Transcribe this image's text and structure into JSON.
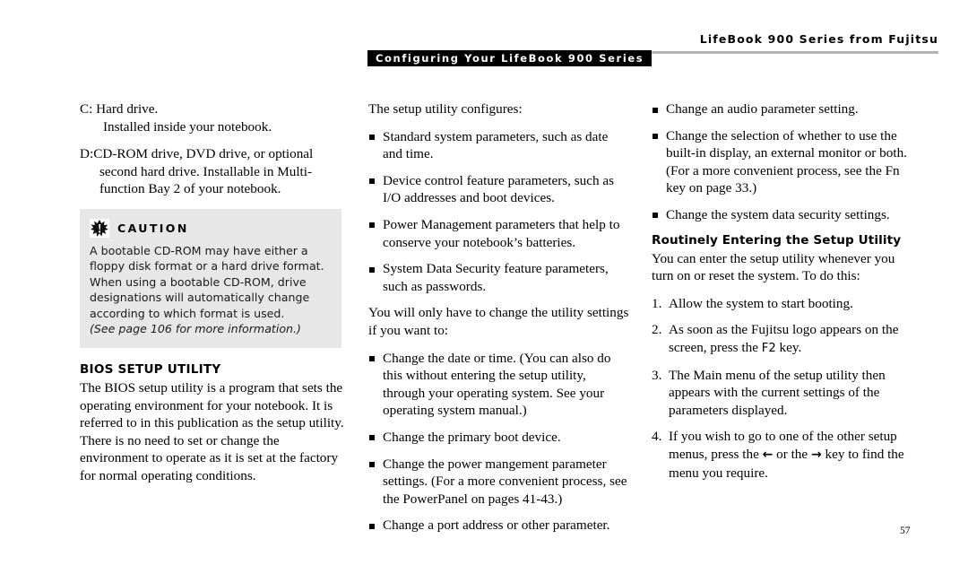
{
  "page": {
    "running_title": "LifeBook 900 Series from Fujitsu",
    "chapter_tab": "Configuring Your LifeBook 900 Series",
    "folio": "57",
    "colors": {
      "tab_background": "#000000",
      "tab_text": "#ffffff",
      "rule": "#b3b3b3",
      "caution_background": "#e7e7e7",
      "body_text": "#000000"
    }
  },
  "left_column": {
    "drive_c": {
      "label": "C:",
      "title": "Hard drive.",
      "detail": "Installed inside your notebook."
    },
    "drive_d": {
      "label": "D:",
      "text": "CD-ROM  drive, DVD drive, or optional second hard drive. Installable in Multi-function Bay 2 of your notebook."
    },
    "caution": {
      "icon": "caution-burst-icon",
      "title": "CAUTION",
      "body": "A bootable CD-ROM may have either a floppy disk format or a hard drive format. When using a bootable CD-ROM, drive designations will automatically change according to which format is used.",
      "note": "(See page 106 for more information.)"
    },
    "bios": {
      "heading": "BIOS SETUP UTILITY",
      "paragraph": "The BIOS setup utility is a program that sets the operating environment for your notebook. It is referred to in this publication as the setup utility. There is no need to set or change the environment to operate as it is set at the factory for normal operating conditions."
    }
  },
  "middle_column": {
    "intro": "The setup utility configures:",
    "configures_list": [
      "Standard system parameters, such as date and time.",
      "Device control feature parameters, such as I/O addresses and boot devices.",
      "Power Management parameters that help to conserve your notebook’s batteries.",
      "System Data Security feature parameters, such as passwords."
    ],
    "change_intro": "You will only have to change the utility settings if you want to:",
    "change_list": [
      "Change the date or time. (You can also do this without entering the setup utility, through your operating system. See your operating system manual.)",
      "Change the primary boot device.",
      "Change the power mangement parameter settings. (For a more convenient process, see the PowerPanel on pages 41-43.)",
      "Change a port address or other parameter."
    ]
  },
  "right_column": {
    "change_list_continued": [
      "Change an audio parameter setting.",
      "Change the selection of whether to use the built-in display, an external monitor or both. (For a more convenient process, see the Fn key on page 33.)",
      "Change the system data security settings."
    ],
    "fn_key_label": "Fn",
    "routinely": {
      "heading": "Routinely Entering the Setup Utility",
      "paragraph": "You can enter the setup utility whenever you turn on or reset the system. To do this:",
      "steps": [
        {
          "number": "1.",
          "text": "Allow the system to start booting."
        },
        {
          "number": "2.",
          "text_before": "As soon as the Fujitsu logo appears on the screen, press the ",
          "key": "F2",
          "text_after": " key."
        },
        {
          "number": "3.",
          "text": "The Main menu of the setup utility then appears with the current settings of the parameters displayed."
        },
        {
          "number": "4.",
          "text_before": "If you wish to go to one of the other setup menus, press the ",
          "arrow_left": "←",
          "text_middle": " or the ",
          "arrow_right": "→",
          "text_after": " key to find the menu you require."
        }
      ]
    }
  }
}
